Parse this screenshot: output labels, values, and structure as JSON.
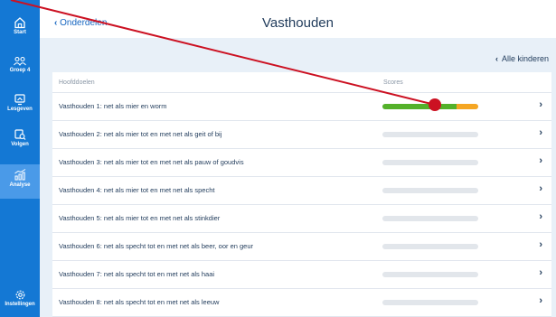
{
  "sidebar": {
    "items": [
      {
        "label": "Start",
        "icon": "home-icon"
      },
      {
        "label": "Groep 4",
        "icon": "group-icon"
      },
      {
        "label": "Lesgeven",
        "icon": "teach-icon"
      },
      {
        "label": "Volgen",
        "icon": "follow-icon"
      },
      {
        "label": "Analyse",
        "icon": "analysis-icon"
      },
      {
        "label": "Instellingen",
        "icon": "settings-icon"
      }
    ],
    "active_index": 4
  },
  "header": {
    "back_label": "Onderdelen",
    "title": "Vasthouden"
  },
  "filter": {
    "all_children_label": "Alle kinderen"
  },
  "table": {
    "columns": [
      "Hoofddoelen",
      "Scores"
    ],
    "rows": [
      {
        "label": "Vasthouden 1: net als mier en worm",
        "scores": {
          "green": 0.77,
          "orange": 0.23
        }
      },
      {
        "label": "Vasthouden 2: net als mier tot en met net als geit of bij",
        "scores": null
      },
      {
        "label": "Vasthouden 3: net als mier tot en met net als pauw of goudvis",
        "scores": null
      },
      {
        "label": "Vasthouden 4: net als mier tot en met net als specht",
        "scores": null
      },
      {
        "label": "Vasthouden 5: net als mier tot en met net als stinkdier",
        "scores": null
      },
      {
        "label": "Vasthouden 6: net als specht tot en met net als beer, oor en geur",
        "scores": null
      },
      {
        "label": "Vasthouden 7: net als specht tot en met net als haai",
        "scores": null
      },
      {
        "label": "Vasthouden 8: net als specht tot en met net als leeuw",
        "scores": null
      }
    ]
  },
  "colors": {
    "sidebar": "#1478d4",
    "sidebar_active": "#4a9ae8",
    "score_green": "#54b12a",
    "score_orange": "#f5a623",
    "annotation": "#cc1122"
  }
}
